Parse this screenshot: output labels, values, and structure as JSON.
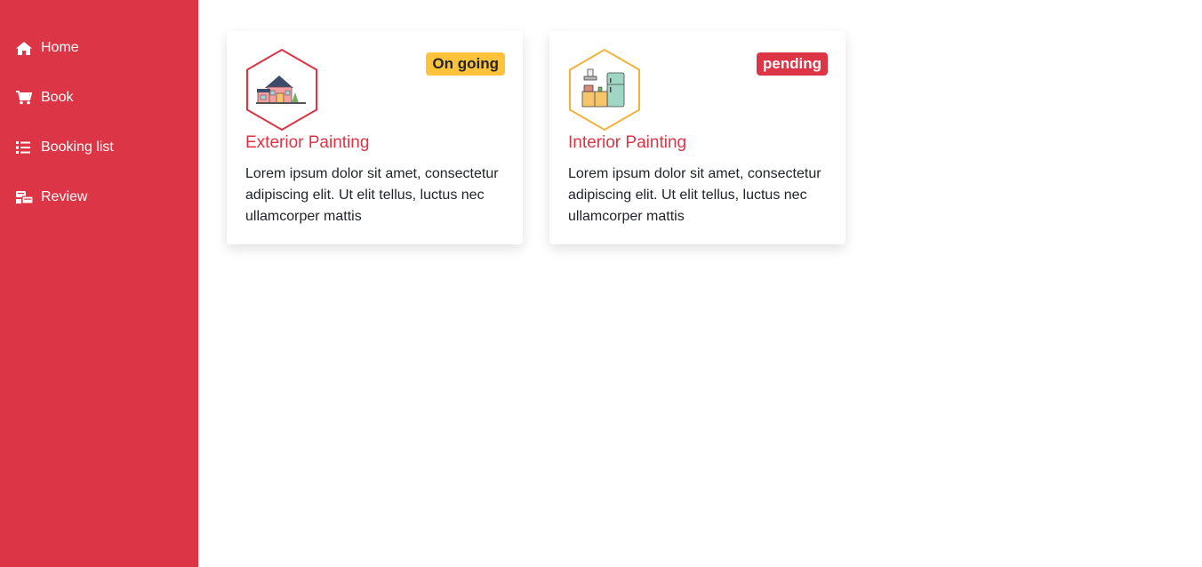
{
  "sidebar": {
    "items": [
      {
        "label": "Home",
        "icon": "home-icon"
      },
      {
        "label": "Book",
        "icon": "cart-icon"
      },
      {
        "label": "Booking list",
        "icon": "list-icon"
      },
      {
        "label": "Review",
        "icon": "review-icon"
      }
    ]
  },
  "cards": [
    {
      "title": "Exterior Painting",
      "status": "On going",
      "description": "Lorem ipsum dolor sit amet, consectetur adipiscing elit. Ut elit tellus, luctus nec ullamcorper mattis",
      "icon": "house-icon",
      "hex_color": "#dc3545",
      "status_color": "#ffc23b"
    },
    {
      "title": "Interior Painting",
      "status": "pending",
      "description": "Lorem ipsum dolor sit amet, consectetur adipiscing elit. Ut elit tellus, luctus nec ullamcorper mattis",
      "icon": "kitchen-icon",
      "hex_color": "#f0b43c",
      "status_color": "#dc3545"
    }
  ],
  "colors": {
    "brand": "#dc3545",
    "warning": "#ffc23b",
    "text": "#212529"
  }
}
